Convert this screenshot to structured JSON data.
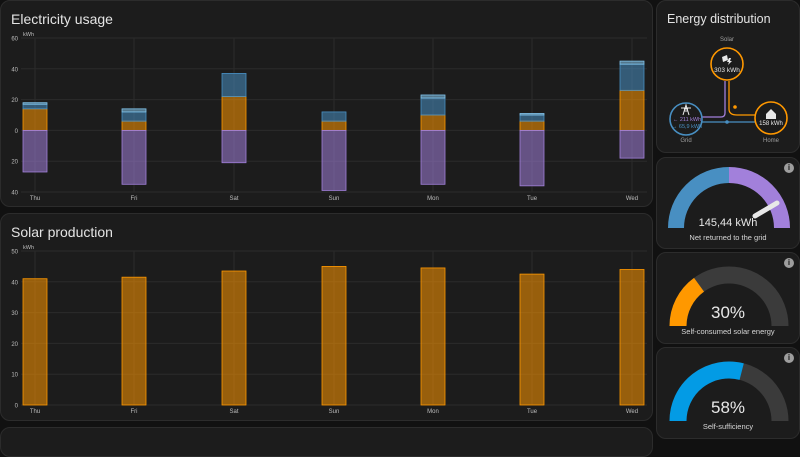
{
  "colors": {
    "solar": "#ff9800",
    "grid_import": "#488fc2",
    "grid_export": "#a280db",
    "home": "#ff9800",
    "gauge_track": "#3b3b3b",
    "self_sufficiency": "#039be5"
  },
  "electricity": {
    "title": "Electricity usage",
    "chart_data": {
      "type": "bar",
      "unit": "kWh",
      "categories": [
        "Thu",
        "Fri",
        "Sat",
        "Sun",
        "Mon",
        "Tue",
        "Wed"
      ],
      "ylim": [
        -40,
        60
      ],
      "yticks": [
        60,
        40,
        20,
        0,
        20,
        40
      ],
      "series": [
        {
          "key": "solar",
          "values": [
            14,
            6,
            22,
            6,
            10,
            6,
            26
          ]
        },
        {
          "key": "grid_import",
          "values": [
            3,
            6,
            15,
            6,
            11,
            4,
            17
          ]
        },
        {
          "key": "battery",
          "values": [
            1,
            2,
            0,
            0,
            2,
            1,
            2
          ]
        },
        {
          "key": "grid_export",
          "values": [
            -27,
            -35,
            -21,
            -39,
            -35,
            -36,
            -18
          ]
        }
      ]
    }
  },
  "solar": {
    "title": "Solar production",
    "chart_data": {
      "type": "bar",
      "unit": "kWh",
      "categories": [
        "Thu",
        "Fri",
        "Sat",
        "Sun",
        "Mon",
        "Tue",
        "Wed"
      ],
      "ylim": [
        0,
        50
      ],
      "yticks": [
        50,
        40,
        30,
        20,
        10,
        0
      ],
      "values": [
        41,
        41.5,
        43.5,
        45,
        44.5,
        42.5,
        44
      ]
    }
  },
  "distribution": {
    "title": "Energy distribution",
    "solar_label": "Solar",
    "solar_value": "303 kWh",
    "grid_label": "Grid",
    "grid_export": "← 211 kWh",
    "grid_import": "→ 65,9 kWh",
    "home_label": "Home",
    "home_value": "158 kWh"
  },
  "gauges": {
    "net": {
      "value": "145,44 kWh",
      "label": "Net returned to the grid",
      "info": "i"
    },
    "self_consumed": {
      "value": "30%",
      "percent": 30,
      "label": "Self-consumed solar energy",
      "info": "i"
    },
    "self_sufficiency": {
      "value": "58%",
      "percent": 58,
      "label": "Self-sufficiency",
      "info": "i"
    }
  }
}
